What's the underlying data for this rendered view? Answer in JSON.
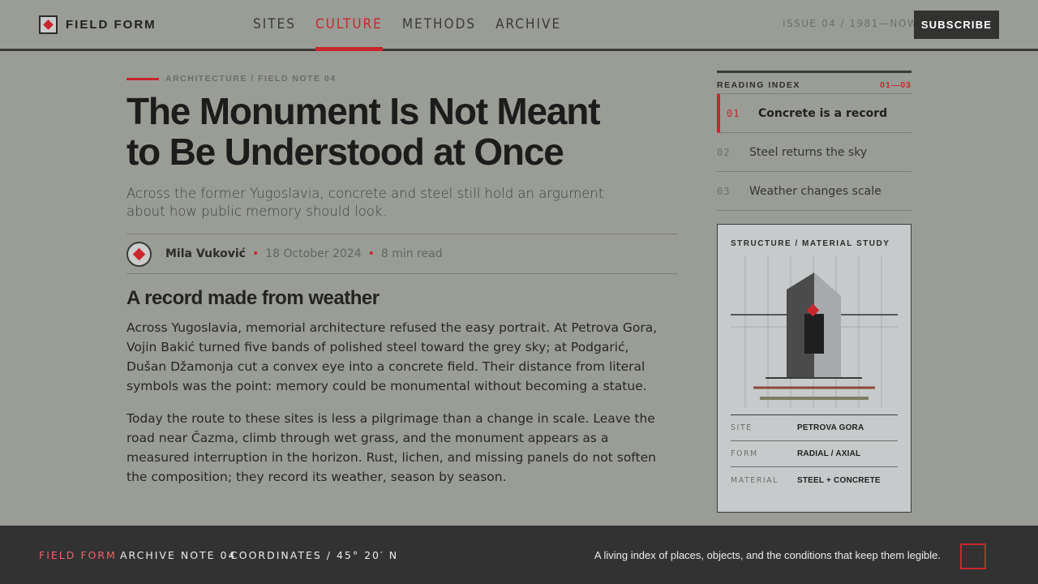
{
  "header": {
    "brand": "FIELD FORM",
    "nav": [
      {
        "label": "SITES",
        "active": false
      },
      {
        "label": "CULTURE",
        "active": true
      },
      {
        "label": "METHODS",
        "active": false
      },
      {
        "label": "ARCHIVE",
        "active": false
      }
    ],
    "issue": "ISSUE 04 / 1981—NOW",
    "subscribe_label": "SUBSCRIBE"
  },
  "article": {
    "kicker": "ARCHITECTURE / FIELD NOTE 04",
    "headline_line1": "The Monument Is Not Meant",
    "headline_line2": "to Be Understood at Once",
    "dek": "Across the former Yugoslavia, concrete and steel still hold an argument about how public memory should look.",
    "author": "Mila Vuković",
    "date": "18 October 2024",
    "read_time": "8 min read",
    "section_title": "A record made from weather",
    "paragraph1": "Across Yugoslavia, memorial architecture refused the easy portrait. At Petrova Gora, Vojin Bakić turned five bands of polished steel toward the grey sky; at Podgarić, Dušan Džamonja cut a convex eye into a concrete field. Their distance from literal symbols was the point: memory could be monumental without becoming a statue.",
    "paragraph2": "Today the route to these sites is less a pilgrimage than a change in scale. Leave the road near Čazma, climb through wet grass, and the monument appears as a measured interruption in the horizon. Rust, lichen, and missing panels do not soften the composition; they record its weather, season by season."
  },
  "reading_index": {
    "title": "READING INDEX",
    "count": "01—03",
    "items": [
      {
        "num": "01",
        "label": "Concrete is a record",
        "active": true
      },
      {
        "num": "02",
        "label": "Steel returns the sky",
        "active": false
      },
      {
        "num": "03",
        "label": "Weather changes scale",
        "active": false
      }
    ]
  },
  "study_card": {
    "title": "STRUCTURE / MATERIAL STUDY",
    "rows": [
      {
        "key": "SITE",
        "value": "PETROVA GORA"
      },
      {
        "key": "FORM",
        "value": "RADIAL / AXIAL"
      },
      {
        "key": "MATERIAL",
        "value": "STEEL + CONCRETE"
      }
    ]
  },
  "footer": {
    "brand": "FIELD FORM",
    "note": "ARCHIVE NOTE 04",
    "coords": "COORDINATES / 45° 20′ N",
    "tagline": "A living index of places, objects, and the conditions that keep them legible."
  },
  "colors": {
    "accent": "#c8272d",
    "page_bg": "#9a9c96",
    "ink": "#1f201f",
    "footer_bg": "#313231"
  },
  "icons": {
    "brand": "diamond-logo-icon",
    "author": "avatar-diamond-icon",
    "footer": "square-outline-icon"
  }
}
